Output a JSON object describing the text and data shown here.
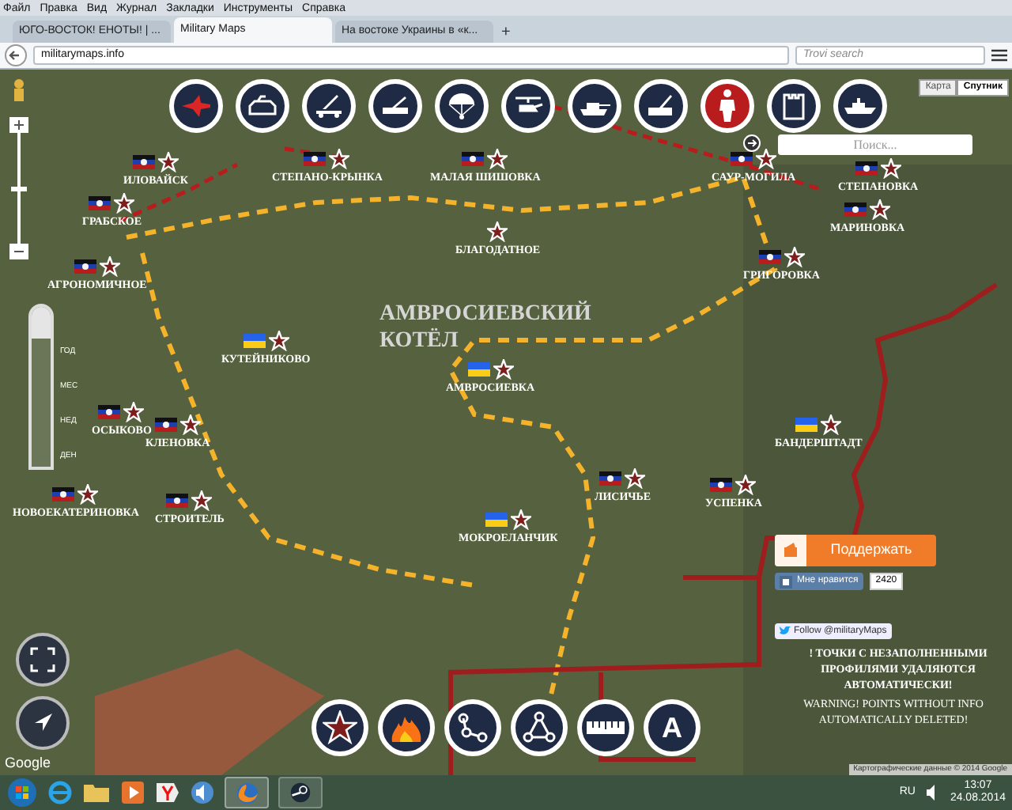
{
  "menu": [
    "Файл",
    "Правка",
    "Вид",
    "Журнал",
    "Закладки",
    "Инструменты",
    "Справка"
  ],
  "tabs": [
    {
      "label": "ЮГО-ВОСТОК! ЕНОТЫ! | ...",
      "selected": false
    },
    {
      "label": "Military Maps",
      "selected": true
    },
    {
      "label": "На востоке Украины в «к...",
      "selected": false
    }
  ],
  "new_tab": "+",
  "address": "militarymaps.info",
  "browser_search": {
    "placeholder": "Trovi search"
  },
  "map": {
    "unit_tools": [
      {
        "kind": "jet",
        "selected": false
      },
      {
        "kind": "armored-car",
        "selected": false
      },
      {
        "kind": "rocket-launcher",
        "selected": false
      },
      {
        "kind": "artillery",
        "selected": false
      },
      {
        "kind": "parachute",
        "selected": false
      },
      {
        "kind": "helicopter",
        "selected": false
      },
      {
        "kind": "tank",
        "selected": false
      },
      {
        "kind": "howitzer",
        "selected": false
      },
      {
        "kind": "soldier",
        "selected": true
      },
      {
        "kind": "fort",
        "selected": false
      },
      {
        "kind": "ship",
        "selected": false
      }
    ],
    "map_type": [
      {
        "label": "Карта",
        "selected": false
      },
      {
        "label": "Спутник",
        "selected": true
      }
    ],
    "search": {
      "placeholder": "Поиск..."
    },
    "time_slider": {
      "level": 1
    },
    "time_scale": [
      "ГОД",
      "МЕС",
      "НЕД",
      "ДЕН"
    ],
    "title": "АМВРОСИЕВСКИЙ КОТЁЛ",
    "places": [
      {
        "name": "ИЛОВАЙСК",
        "kind": "dnr"
      },
      {
        "name": "ГРАБСКОЕ",
        "kind": "dnr"
      },
      {
        "name": "АГРОНОМИЧНОЕ",
        "kind": "dnr"
      },
      {
        "name": "СТЕПАНО-КРЫНКА",
        "kind": "dnr"
      },
      {
        "name": "МАЛАЯ ШИШОВКА",
        "kind": "dnr"
      },
      {
        "name": "БЛАГОДАТНОЕ",
        "kind": "none"
      },
      {
        "name": "САУР-МОГИЛА",
        "kind": "dnr"
      },
      {
        "name": "СТЕПАНОВКА",
        "kind": "dnr"
      },
      {
        "name": "МАРИНОВКА",
        "kind": "dnr"
      },
      {
        "name": "ГРИГОРОВКА",
        "kind": "dnr"
      },
      {
        "name": "КУТЕЙНИКОВО",
        "kind": "ukraine"
      },
      {
        "name": "АМВРОСИЕВКА",
        "kind": "ukraine"
      },
      {
        "name": "ОСЫКОВО",
        "kind": "dnr"
      },
      {
        "name": "КЛЕНОВКА",
        "kind": "dnr"
      },
      {
        "name": "НОВОЕКАТЕРИНОВКА",
        "kind": "dnr"
      },
      {
        "name": "СТРОИТЕЛЬ",
        "kind": "dnr"
      },
      {
        "name": "ЛИСИЧЬЕ",
        "kind": "dnr"
      },
      {
        "name": "УСПЕНКА",
        "kind": "dnr"
      },
      {
        "name": "МОКРОЕЛАНЧИК",
        "kind": "ukraine"
      },
      {
        "name": "БАНДЕРШТАДТ",
        "kind": "ukraine"
      }
    ],
    "support_button": "Поддержать",
    "like": {
      "label": "Мне нравится",
      "count": "2420"
    },
    "follow": "Follow @militaryMaps",
    "notice_ru": "! ТОЧКИ С НЕЗАПОЛНЕННЫМИ ПРОФИЛЯМИ УДАЛЯЮТСЯ АВТОМАТИЧЕСКИ!",
    "notice_en": "WARNING! POINTS WITHOUT INFO AUTOMATICALLY DELETED!",
    "draw_tools": [
      {
        "kind": "star"
      },
      {
        "kind": "fire"
      },
      {
        "kind": "path"
      },
      {
        "kind": "triangle"
      },
      {
        "kind": "ruler"
      },
      {
        "kind": "text",
        "label": "A"
      }
    ],
    "google": "Google",
    "attribution": "Картографические данные © 2014 Google"
  },
  "taskbar": {
    "language": "RU",
    "time": "13:07",
    "date": "24.08.2014"
  }
}
